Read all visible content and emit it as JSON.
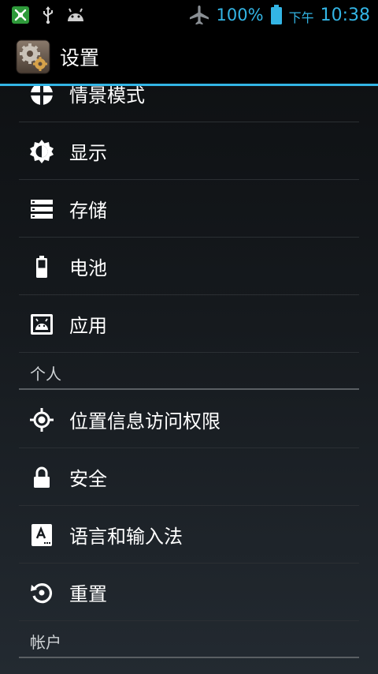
{
  "status_bar": {
    "battery_percent": "100%",
    "ampm": "下午",
    "time": "10:38",
    "accent_color": "#33b5e5"
  },
  "action_bar": {
    "title": "设置",
    "app_icon": "settings-gears-icon"
  },
  "items": [
    {
      "label": "情景模式",
      "icon": "audio-profile-icon"
    },
    {
      "label": "显示",
      "icon": "brightness-icon"
    },
    {
      "label": "存储",
      "icon": "storage-icon"
    },
    {
      "label": "电池",
      "icon": "battery-icon"
    },
    {
      "label": "应用",
      "icon": "apps-icon"
    }
  ],
  "section_personal": {
    "title": "个人"
  },
  "personal_items": [
    {
      "label": "位置信息访问权限",
      "icon": "location-icon"
    },
    {
      "label": "安全",
      "icon": "lock-icon"
    },
    {
      "label": "语言和输入法",
      "icon": "language-keyboard-icon"
    },
    {
      "label": "重置",
      "icon": "reset-icon"
    }
  ],
  "section_accounts": {
    "title": "帐户"
  }
}
